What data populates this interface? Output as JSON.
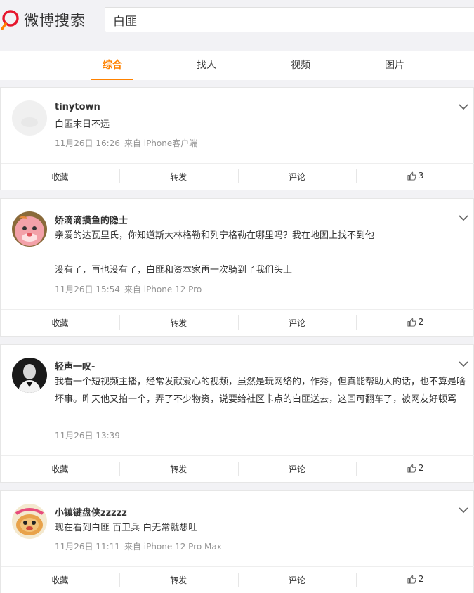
{
  "header": {
    "logo_text": "微博搜索",
    "search_value": "白匪"
  },
  "tabs": [
    {
      "label": "综合",
      "active": true
    },
    {
      "label": "找人",
      "active": false
    },
    {
      "label": "视频",
      "active": false
    },
    {
      "label": "图片",
      "active": false
    }
  ],
  "posts": [
    {
      "user": "tinytown",
      "paragraphs": [
        "白匪末日不远"
      ],
      "time": "11月26日 16:26",
      "source": "来自 iPhone客户端",
      "actions": {
        "collect": "收藏",
        "repost": "转发",
        "comment": "评论",
        "likes": "3"
      }
    },
    {
      "user": "娇滴滴摸鱼的隐士",
      "paragraphs": [
        "亲爱的达瓦里氏，你知道斯大林格勒和列宁格勒在哪里吗？我在地图上找不到他",
        "没有了，再也没有了，白匪和资本家再一次骑到了我们头上"
      ],
      "time": "11月26日 15:54",
      "source": "来自 iPhone 12 Pro",
      "actions": {
        "collect": "收藏",
        "repost": "转发",
        "comment": "评论",
        "likes": "2"
      }
    },
    {
      "user": "轻声一叹-",
      "paragraphs": [
        "我看一个短视频主播，经常发献爱心的视频，虽然是玩网络的，作秀，但真能帮助人的话，也不算是啥坏事。昨天他又拍一个，弄了不少物资，说要给社区卡点的白匪送去，这回可翻车了，被网友好顿骂"
      ],
      "time": "11月26日 13:39",
      "source": "",
      "actions": {
        "collect": "收藏",
        "repost": "转发",
        "comment": "评论",
        "likes": "2"
      }
    },
    {
      "user": "小镇键盘侠zzzzz",
      "paragraphs": [
        "现在看到白匪 百卫兵 白无常就想吐"
      ],
      "time": "11月26日 11:11",
      "source": "来自 iPhone 12 Pro Max",
      "actions": {
        "collect": "收藏",
        "repost": "转发",
        "comment": "评论",
        "likes": "2"
      }
    }
  ],
  "colors": {
    "accent": "#ff8200",
    "logo_red": "#e6162d",
    "meta": "#939393"
  }
}
